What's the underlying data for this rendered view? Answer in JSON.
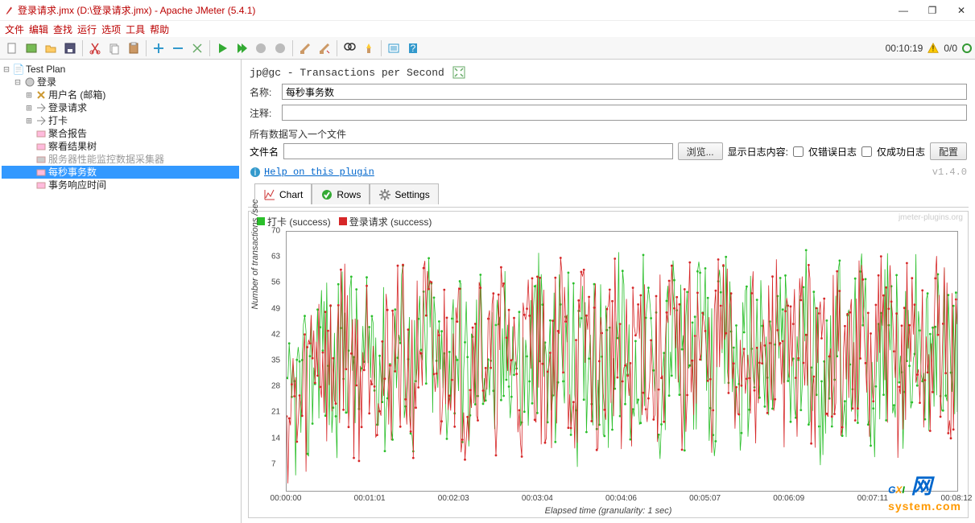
{
  "window": {
    "title": "登录请求.jmx (D:\\登录请求.jmx) - Apache JMeter (5.4.1)"
  },
  "menu": [
    "文件",
    "编辑",
    "查找",
    "运行",
    "选项",
    "工具",
    "帮助"
  ],
  "timer": "00:10:19",
  "counter": "0/0",
  "tree": {
    "root": "Test Plan",
    "n1": "登录",
    "items": [
      {
        "label": "用户名 (邮箱)",
        "icon": "var"
      },
      {
        "label": "登录请求",
        "icon": "http"
      },
      {
        "label": "打卡",
        "icon": "http"
      },
      {
        "label": "聚合报告",
        "icon": "rep"
      },
      {
        "label": "察看结果树",
        "icon": "rep"
      },
      {
        "label": "服务器性能监控数据采集器",
        "icon": "rep",
        "dim": true
      },
      {
        "label": "每秒事务数",
        "icon": "rep",
        "sel": true
      },
      {
        "label": "事务响应时间",
        "icon": "rep"
      }
    ]
  },
  "panel": {
    "title": "jp@gc - Transactions per Second",
    "name_label": "名称:",
    "name_value": "每秒事务数",
    "comment_label": "注释:",
    "comment_value": "",
    "write_all": "所有数据写入一个文件",
    "file_label": "文件名",
    "file_value": "",
    "browse": "浏览...",
    "showlog": "显示日志内容:",
    "err_only": "仅错误日志",
    "ok_only": "仅成功日志",
    "config": "配置",
    "help": "Help on this plugin",
    "version": "v1.4.0",
    "tabs": {
      "chart": "Chart",
      "rows": "Rows",
      "settings": "Settings"
    }
  },
  "chart_data": {
    "type": "line",
    "title": "",
    "xlabel": "Elapsed time (granularity: 1 sec)",
    "ylabel": "Number of transactions /sec",
    "yticks": [
      7,
      14,
      21,
      28,
      35,
      42,
      49,
      56,
      63,
      70
    ],
    "ylim": [
      0,
      70
    ],
    "xticks": [
      "00:00:00",
      "00:01:01",
      "00:02:03",
      "00:03:04",
      "00:04:06",
      "00:05:07",
      "00:06:09",
      "00:07:11",
      "00:08:12"
    ],
    "x_range_sec": [
      0,
      520
    ],
    "legend": [
      {
        "name": "打卡 (success)",
        "color": "#2bbf2b"
      },
      {
        "name": "登录请求 (success)",
        "color": "#d62728"
      }
    ],
    "watermark": "jmeter-plugins.org",
    "series": [
      {
        "name": "打卡 (success)",
        "color": "#2bbf2b",
        "mean": 36,
        "amp": 24
      },
      {
        "name": "登录请求 (success)",
        "color": "#d62728",
        "mean": 36,
        "amp": 24
      }
    ],
    "note": "High-frequency noisy TPS lines oscillating roughly between 5 and 66, centered ~35; ~520 samples each. Exact per-second values not individually legible; render as jittered lines within [ylim]."
  },
  "logo": {
    "text": "GXI 网",
    "sub": "system.com"
  }
}
